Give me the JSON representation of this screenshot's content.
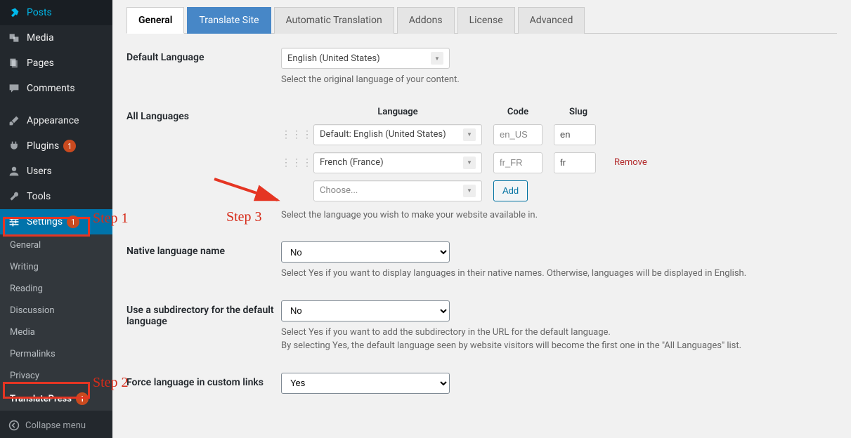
{
  "sidebar": {
    "main": [
      {
        "icon": "pin",
        "label": "Posts"
      },
      {
        "icon": "media",
        "label": "Media"
      },
      {
        "icon": "page",
        "label": "Pages"
      },
      {
        "icon": "comment",
        "label": "Comments"
      },
      {
        "icon": "brush",
        "label": "Appearance"
      },
      {
        "icon": "plug",
        "label": "Plugins",
        "badge": "1"
      },
      {
        "icon": "user",
        "label": "Users"
      },
      {
        "icon": "wrench",
        "label": "Tools"
      },
      {
        "icon": "sliders",
        "label": "Settings",
        "badge": "1",
        "active": true
      }
    ],
    "sub": [
      {
        "label": "General"
      },
      {
        "label": "Writing"
      },
      {
        "label": "Reading"
      },
      {
        "label": "Discussion"
      },
      {
        "label": "Media"
      },
      {
        "label": "Permalinks"
      },
      {
        "label": "Privacy"
      },
      {
        "label": "TranslatePress",
        "badge": "1"
      }
    ],
    "collapse": "Collapse menu"
  },
  "annotations": {
    "step1": "Step 1",
    "step2": "Step 2",
    "step3": "Step 3"
  },
  "tabs": [
    {
      "label": "General",
      "state": "current"
    },
    {
      "label": "Translate Site",
      "state": "highlight"
    },
    {
      "label": "Automatic Translation"
    },
    {
      "label": "Addons"
    },
    {
      "label": "License"
    },
    {
      "label": "Advanced"
    }
  ],
  "form": {
    "default_language": {
      "label": "Default Language",
      "value": "English (United States)",
      "desc": "Select the original language of your content."
    },
    "all_languages": {
      "label": "All Languages",
      "headers": {
        "language": "Language",
        "code": "Code",
        "slug": "Slug"
      },
      "rows": [
        {
          "language": "Default: English (United States)",
          "code": "en_US",
          "slug": "en",
          "removable": false
        },
        {
          "language": "French (France)",
          "code": "fr_FR",
          "slug": "fr",
          "removable": true
        }
      ],
      "add_placeholder": "Choose...",
      "add_label": "Add",
      "remove_label": "Remove",
      "desc": "Select the language you wish to make your website available in."
    },
    "native_name": {
      "label": "Native language name",
      "value": "No",
      "desc": "Select Yes if you want to display languages in their native names. Otherwise, languages will be displayed in English."
    },
    "subdir": {
      "label": "Use a subdirectory for the default language",
      "value": "No",
      "desc1": "Select Yes if you want to add the subdirectory in the URL for the default language.",
      "desc2": "By selecting Yes, the default language seen by website visitors will become the first one in the \"All Languages\" list."
    },
    "force_links": {
      "label": "Force language in custom links",
      "value": "Yes"
    }
  }
}
